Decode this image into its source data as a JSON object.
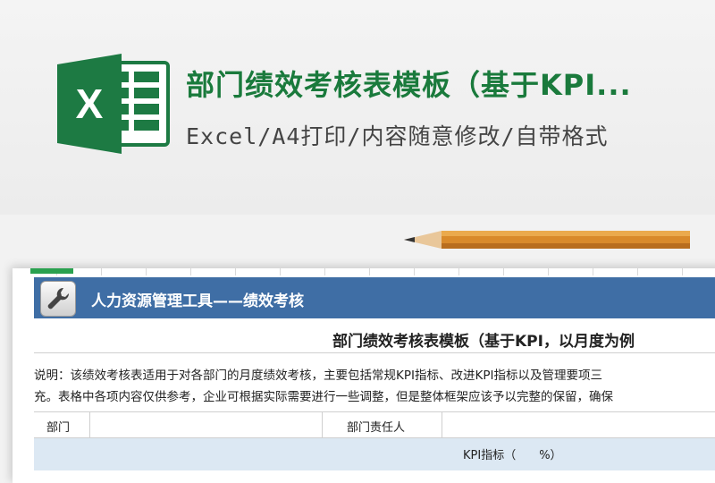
{
  "header": {
    "app_icon": "excel-icon",
    "app_icon_letter": "X",
    "title": "部门绩效考核表模板（基于KPI...",
    "subtitle": "Excel/A4打印/内容随意修改/自带格式",
    "title_color": "#1a7a3c",
    "excel_green": "#1d7a43"
  },
  "sheet": {
    "banner_icon": "wrench-icon",
    "banner_text": "人力资源管理工具——绩效考核",
    "banner_color": "#3f6ea5",
    "title": "部门绩效考核表模板（基于KPI，以月度为例",
    "notes": [
      "说明：该绩效考核表适用于对各部门的月度绩效考核，主要包括常规KPI指标、改进KPI指标以及管理要项三",
      "充。表格中各项内容仅供参考，企业可根据实际需要进行一些调整，但是整体框架应该予以完整的保留，确保"
    ],
    "fields": {
      "department_label": "部门",
      "department_value": "",
      "manager_label": "部门责任人",
      "manager_value": ""
    },
    "kpi_header": "KPI指标（　　%）",
    "kpi_row_color": "#dce8f3"
  },
  "decor": {
    "pencil_icon": "pencil-icon"
  }
}
